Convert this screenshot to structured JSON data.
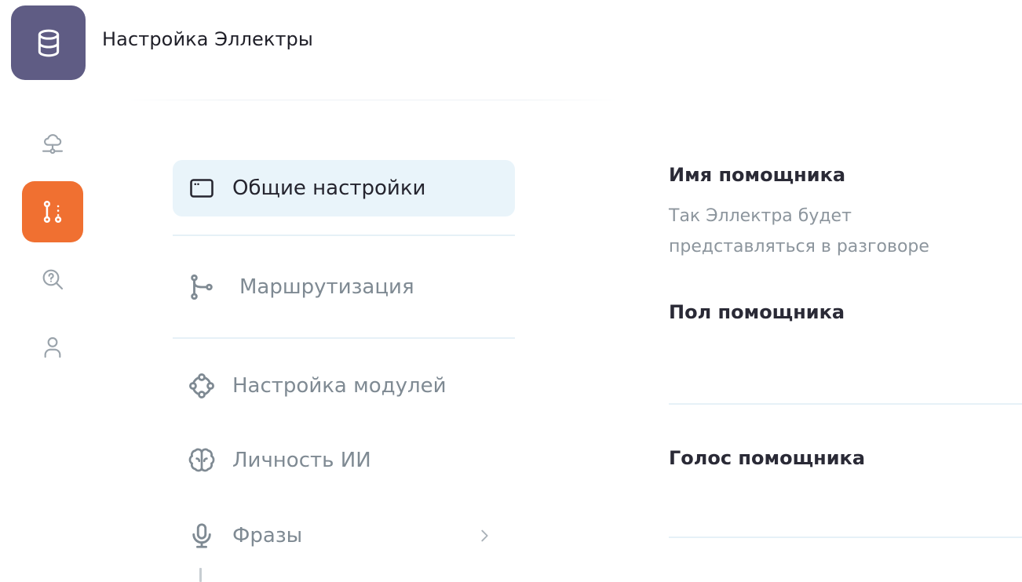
{
  "app": {
    "title": "Настройка Эллектры",
    "logo_icon": "database-icon",
    "logo_color": "#5f5c84"
  },
  "rail": {
    "items": [
      {
        "icon": "cloud-network-icon",
        "active": false
      },
      {
        "icon": "routing-icon",
        "active": true
      },
      {
        "icon": "search-help-icon",
        "active": false
      },
      {
        "icon": "user-icon",
        "active": false
      }
    ],
    "active_color": "#f07031"
  },
  "menu": {
    "items": [
      {
        "label": "Общие настройки",
        "icon": "window-icon",
        "active": true
      },
      {
        "label": "Маршрутизация",
        "icon": "git-branch-icon",
        "active": false
      },
      {
        "label": "Настройка модулей",
        "icon": "modules-icon",
        "active": false
      },
      {
        "label": "Личность ИИ",
        "icon": "brain-icon",
        "active": false
      },
      {
        "label": "Фразы",
        "icon": "microphone-icon",
        "active": false,
        "has_chevron": true
      }
    ]
  },
  "settings": {
    "assistant_name": {
      "label": "Имя помощника",
      "description": "Так Эллектра будет представляться в разговоре"
    },
    "assistant_gender": {
      "label": "Пол помощника"
    },
    "assistant_voice": {
      "label": "Голос помощника"
    }
  }
}
